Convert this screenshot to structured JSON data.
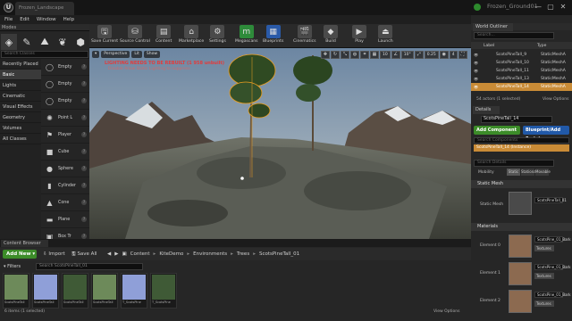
{
  "window": {
    "tab_title": "Frozen_Landscape",
    "project": "Frozen_Ground01",
    "logo": "U",
    "buttons": {
      "minimize": "—",
      "maximize": "▢",
      "close": "✕"
    }
  },
  "menu": [
    "File",
    "Edit",
    "Window",
    "Help"
  ],
  "modes": {
    "tab": "Modes",
    "icons": [
      "place-icon",
      "paint-icon",
      "landscape-icon",
      "foliage-icon",
      "geometry-icon"
    ],
    "search_placeholder": "Search Classes",
    "categories": [
      "Recently Placed",
      "Basic",
      "Lights",
      "Cinematic",
      "Visual Effects",
      "Geometry",
      "Volumes",
      "All Classes"
    ],
    "selected_category": 1,
    "items": [
      {
        "label": "Empty",
        "icon": "◯"
      },
      {
        "label": "Empty",
        "icon": "◯"
      },
      {
        "label": "Empty",
        "icon": "◯"
      },
      {
        "label": "Point L",
        "icon": "✺"
      },
      {
        "label": "Player",
        "icon": "⚑"
      },
      {
        "label": "Cube",
        "icon": "■"
      },
      {
        "label": "Sphere",
        "icon": "●"
      },
      {
        "label": "Cylinder",
        "icon": "▮"
      },
      {
        "label": "Cone",
        "icon": "▲"
      },
      {
        "label": "Plane",
        "icon": "▬"
      },
      {
        "label": "Box Tr",
        "icon": "▣"
      }
    ]
  },
  "toolbar": [
    {
      "label": "Save Current",
      "icon": "🖫",
      "color": "#4a4a4a"
    },
    {
      "label": "Source Control",
      "icon": "⛁",
      "color": "#4a4a4a"
    },
    {
      "label": "Content",
      "icon": "▤",
      "color": "#4a4a4a"
    },
    {
      "label": "Marketplace",
      "icon": "⌂",
      "color": "#4a4a4a"
    },
    {
      "label": "Settings",
      "icon": "⚙",
      "color": "#4a4a4a"
    },
    {
      "label": "Megascans",
      "icon": "m",
      "color": "#2e8b3a"
    },
    {
      "label": "Blueprints",
      "icon": "▦",
      "color": "#2a5aa8"
    },
    {
      "label": "Cinematics",
      "icon": "🎬",
      "color": "#4a4a4a"
    },
    {
      "label": "Build",
      "icon": "◆",
      "color": "#4a4a4a"
    },
    {
      "label": "Play",
      "icon": "▶",
      "color": "#4a4a4a"
    },
    {
      "label": "Launch",
      "icon": "⏏",
      "color": "#4a4a4a"
    }
  ],
  "viewport": {
    "perspective": "Perspective",
    "lit": "Lit",
    "show": "Show",
    "warning": "LIGHTING NEEDS TO BE REBUILT (1 958 unbuilt)",
    "warning2": "Disable Allow Static Lighting to suppress",
    "grid_snap": "10",
    "rotation_snap": "10°",
    "scale_snap": "0.25",
    "camera_speed": "4"
  },
  "content_browser": {
    "tab": "Content Browser",
    "add_new": "Add New",
    "import": "Import",
    "save_all": "Save All",
    "path": [
      "Content",
      "KiteDemo",
      "Environments",
      "Trees",
      "ScotsPineTall_01"
    ],
    "filters": "Filters",
    "search_placeholder": "Search ScotsPineTall_01",
    "assets": [
      {
        "name": "ScotsPineTall",
        "kind": "tree"
      },
      {
        "name": "ScotsPineTall",
        "kind": "blue"
      },
      {
        "name": "ScotsPineTall",
        "kind": "dark"
      },
      {
        "name": "ScotsPineTall",
        "kind": "tree"
      },
      {
        "name": "T_ScotsPine",
        "kind": "blue"
      },
      {
        "name": "T_ScotsPine",
        "kind": "dark"
      }
    ],
    "status": "6 items (1 selected)",
    "view_options": "View Options"
  },
  "world_outliner": {
    "tab": "World Outliner",
    "search_placeholder": "Search...",
    "col_label": "Label",
    "col_type": "Type",
    "rows": [
      {
        "label": "ScotsPineTall_9",
        "type": "StaticMeshA",
        "selected": false
      },
      {
        "label": "ScotsPineTall_10",
        "type": "StaticMeshA",
        "selected": false
      },
      {
        "label": "ScotsPineTall_11",
        "type": "StaticMeshA",
        "selected": false
      },
      {
        "label": "ScotsPineTall_13",
        "type": "StaticMeshA",
        "selected": false
      },
      {
        "label": "ScotsPineTall_14",
        "type": "StaticMeshA",
        "selected": true
      }
    ],
    "count": "54 actors (1 selected)",
    "view_options": "View Options"
  },
  "details": {
    "tab": "Details",
    "actor_name": "ScotsPineTall_14",
    "add_component": "Add Component",
    "blueprint_script": "Blueprint/Add Script",
    "search_components": "Search Components",
    "component": "ScotsPineTall_14 (Instance)",
    "search_details": "Search Details",
    "mobility_label": "Mobility",
    "mobility": [
      "Static",
      "Stationary",
      "Movable"
    ],
    "static_mesh_section": "Static Mesh",
    "static_mesh_label": "Static Mesh",
    "static_mesh_value": "ScotsPineTall_01",
    "materials_section": "Materials",
    "elements": [
      {
        "label": "Element 0",
        "value": "ScotsPine_01_Bark",
        "tex": "Textures"
      },
      {
        "label": "Element 1",
        "value": "ScotsPine_01_Bark",
        "tex": "Textures"
      },
      {
        "label": "Element 2",
        "value": "ScotsPine_01_Bark",
        "tex": "Textures"
      }
    ]
  }
}
